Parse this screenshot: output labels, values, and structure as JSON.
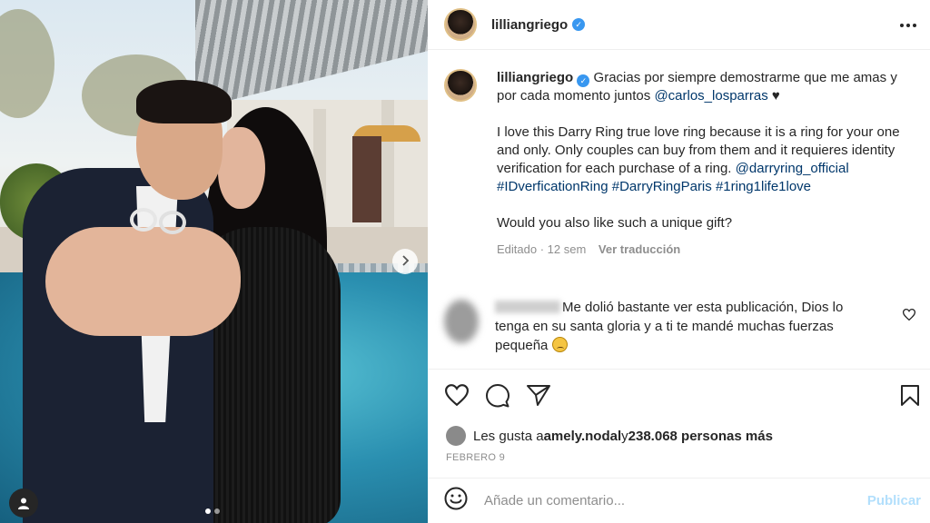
{
  "post": {
    "next_icon": "chevron-right",
    "slide_count": 2,
    "active_slide": 1,
    "tag_icon": "user-tag"
  },
  "header": {
    "username": "lilliangriego",
    "verified_icon": "verified-badge",
    "more_icon": "more-horizontal"
  },
  "caption": {
    "username": "lilliangriego",
    "text1": "Gracias por siempre demostrarme que me amas y por cada momento juntos ",
    "mention": "@carlos_losparras",
    "heart": " ♥",
    "text2": "I love this Darry Ring true love ring because it is a ring for your one and only. Only couples can buy from them and it requieres identity verification for each purchase of a ring.",
    "tags": [
      "@darryring_official",
      "#IDverficationRing",
      "#DarryRingParis",
      "#1ring1life1love"
    ],
    "text3": "Would you also like such a unique gift?",
    "edited": "Editado · 12 sem",
    "translate": "Ver traducción"
  },
  "comment": {
    "text": "Me dolió bastante ver esta publicación, Dios lo tenga en su santa gloria y a ti te mandé muchas fuerzas pequeña"
  },
  "actions": {
    "like_icon": "heart-outline",
    "comment_icon": "comment-bubble",
    "share_icon": "paper-plane",
    "save_icon": "bookmark"
  },
  "likes": {
    "prefix": "Les gusta a ",
    "user": "amely.nodal",
    "connector": " y ",
    "count": "238.068 personas más"
  },
  "date": "FEBRERO 9",
  "add_comment": {
    "placeholder": "Añade un comentario...",
    "emoji_icon": "smiley",
    "publish": "Publicar"
  },
  "colors": {
    "link": "#00376b",
    "verified": "#3897f0",
    "publish_disabled": "#b2dffc"
  }
}
